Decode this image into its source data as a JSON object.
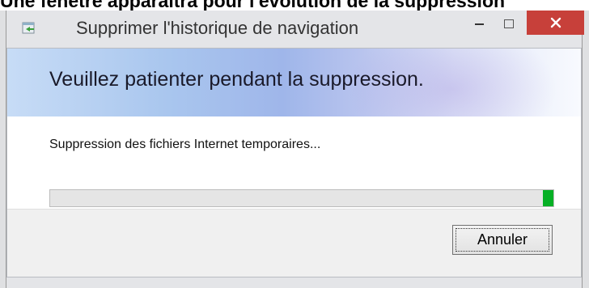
{
  "caption": "Une fenêtre apparaîtra pour l'évolution de la suppression",
  "window": {
    "title": "Supprimer l'historique de navigation",
    "banner_title": "Veuillez patienter pendant la suppression.",
    "status_text": "Suppression des fichiers Internet temporaires...",
    "progress": 0.98,
    "cancel_label": "Annuler"
  },
  "colors": {
    "close_button": "#c7403a",
    "progress_fill": "#06b025"
  },
  "icons": [
    "app-icon",
    "minimize-icon",
    "maximize-icon",
    "close-icon"
  ]
}
